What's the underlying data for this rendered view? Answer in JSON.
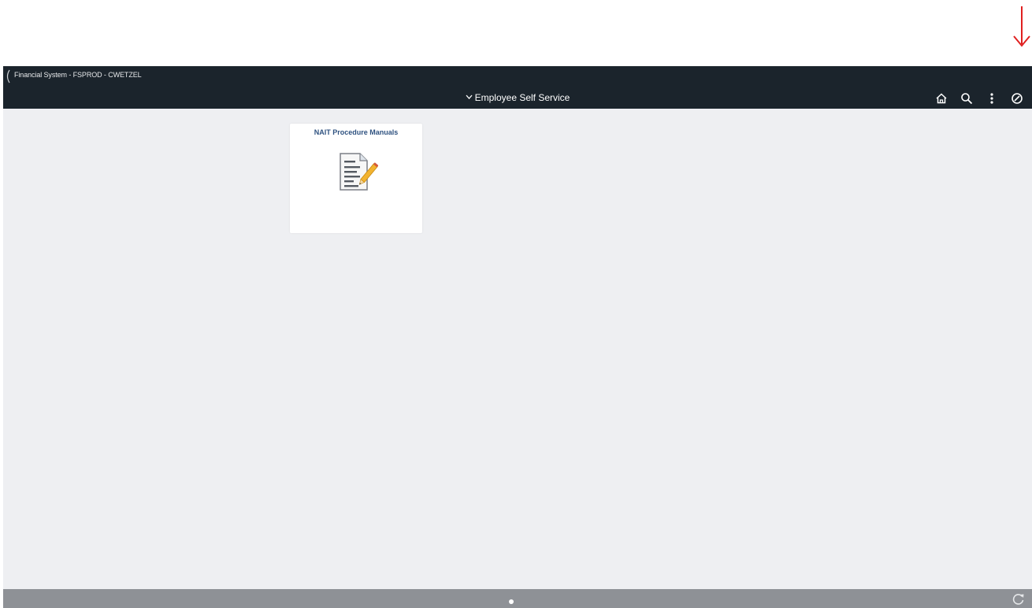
{
  "banner": {
    "system_title": "Financial System - FSPROD - CWETZEL",
    "page_title": "Employee Self Service"
  },
  "tiles": [
    {
      "title": "NAIT Procedure Manuals",
      "icon": "document-edit-icon"
    }
  ],
  "toolbar": {
    "icons": [
      "home-icon",
      "search-icon",
      "actions-menu-icon",
      "navbar-icon"
    ]
  },
  "footer": {
    "page_indicator_count": 1,
    "icons": [
      "refresh-icon"
    ]
  },
  "colors": {
    "banner_bg": "#1b242c",
    "content_bg": "#eeeff2",
    "footer_bg": "#8e9196",
    "tile_title": "#2f5280",
    "annotation_arrow": "#e02020"
  }
}
